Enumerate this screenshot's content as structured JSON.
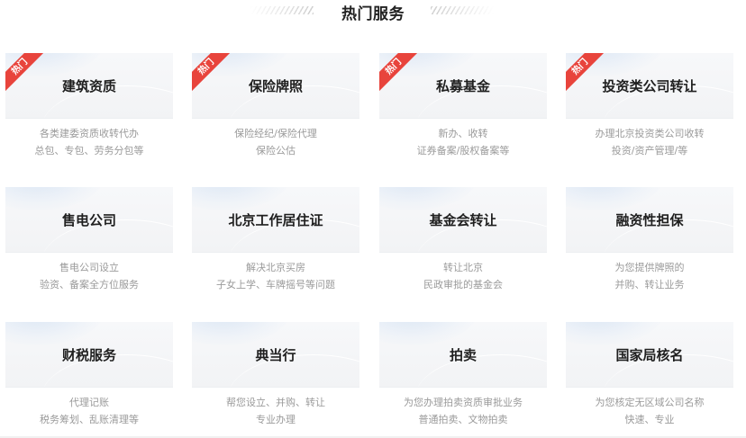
{
  "section": {
    "title": "热门服务"
  },
  "colors": {
    "badge": "#e8443c",
    "card_title": "#1f1f1f",
    "card_desc": "#9a9a9a",
    "card_top_bg": "#f5f6f8"
  },
  "cards": [
    {
      "title": "建筑资质",
      "badge": "热门",
      "desc": [
        "各类建委资质收转代办",
        "总包、专包、劳务分包等"
      ]
    },
    {
      "title": "保险牌照",
      "badge": "热门",
      "desc": [
        "保险经纪/保险代理",
        "保险公估"
      ]
    },
    {
      "title": "私募基金",
      "badge": "热门",
      "desc": [
        "新办、收转",
        "证券备案/股权备案等"
      ]
    },
    {
      "title": "投资类公司转让",
      "badge": "热门",
      "desc": [
        "办理北京投资类公司收转",
        "投资/资产管理/等"
      ]
    },
    {
      "title": "售电公司",
      "desc": [
        "售电公司设立",
        "验资、备案全方位服务"
      ]
    },
    {
      "title": "北京工作居住证",
      "desc": [
        "解决北京买房",
        "子女上学、车牌摇号等问题"
      ]
    },
    {
      "title": "基金会转让",
      "desc": [
        "转让北京",
        "民政审批的基金会"
      ]
    },
    {
      "title": "融资性担保",
      "desc": [
        "为您提供牌照的",
        "并购、转让业务"
      ]
    },
    {
      "title": "财税服务",
      "desc": [
        "代理记账",
        "税务筹划、乱账清理等"
      ]
    },
    {
      "title": "典当行",
      "desc": [
        "帮您设立、并购、转让",
        "专业办理"
      ]
    },
    {
      "title": "拍卖",
      "desc": [
        "为您办理拍卖资质审批业务",
        "普通拍卖、文物拍卖"
      ]
    },
    {
      "title": "国家局核名",
      "desc": [
        "为您核定无区域公司名称",
        "快速、专业"
      ]
    }
  ]
}
